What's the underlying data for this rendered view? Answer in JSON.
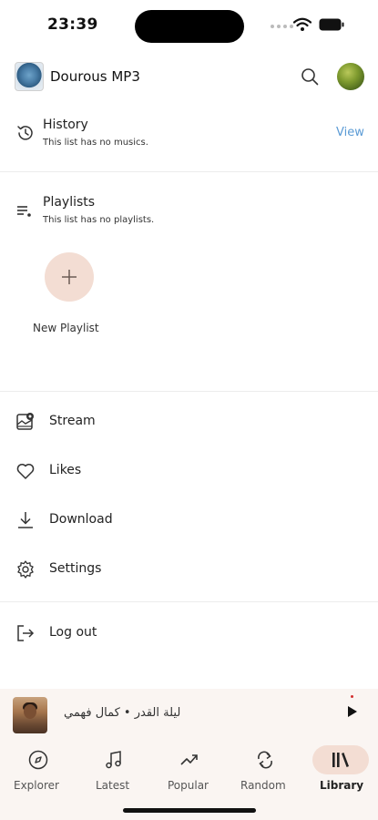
{
  "status_bar": {
    "time": "23:39"
  },
  "header": {
    "title": "Dourous MP3"
  },
  "history": {
    "title": "History",
    "subtitle": "This list has no musics.",
    "view_label": "View"
  },
  "playlists": {
    "title": "Playlists",
    "subtitle": "This list has no playlists.",
    "new_label": "New Playlist"
  },
  "menu": {
    "items": [
      {
        "label": "Stream",
        "icon": "stream-icon"
      },
      {
        "label": "Likes",
        "icon": "heart-icon"
      },
      {
        "label": "Download",
        "icon": "download-icon"
      },
      {
        "label": "Settings",
        "icon": "gear-icon"
      }
    ],
    "logout": {
      "label": "Log out",
      "icon": "logout-icon"
    }
  },
  "player": {
    "track": "ليلة القدر • كمال فهمي"
  },
  "nav": {
    "tabs": [
      {
        "label": "Explorer",
        "icon": "compass-icon"
      },
      {
        "label": "Latest",
        "icon": "music-note-icon"
      },
      {
        "label": "Popular",
        "icon": "trending-icon"
      },
      {
        "label": "Random",
        "icon": "repeat-icon"
      },
      {
        "label": "Library",
        "icon": "library-icon"
      }
    ],
    "active": "Library"
  },
  "colors": {
    "accent_pill": "#f3ddd3",
    "link": "#5b9bd5",
    "player_bg": "#faf5f2"
  }
}
